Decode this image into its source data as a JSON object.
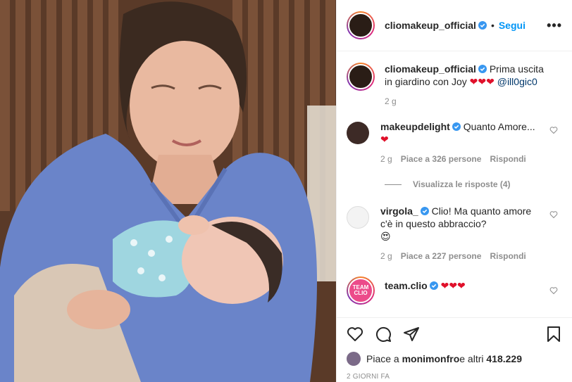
{
  "post": {
    "author": "cliomakeup_official",
    "follow_label": "Segui",
    "more_label": "•••",
    "caption_text": "Prima uscita in giardino con Joy",
    "caption_hearts": "❤❤❤",
    "caption_mention": "@ill0gic0",
    "caption_time": "2 g"
  },
  "comments": [
    {
      "user": "makeupdelight",
      "verified": true,
      "text": "Quanto Amore...",
      "emoji": "❤",
      "time": "2 g",
      "likes": "Piace a 326 persone",
      "reply": "Rispondi",
      "view_replies": "Visualizza le risposte (4)"
    },
    {
      "user": "virgola_",
      "verified": true,
      "text": "Clio! Ma quanto amore c'è in questo abbraccio?",
      "emoji": "😍",
      "time": "2 g",
      "likes": "Piace a 227 persone",
      "reply": "Rispondi"
    },
    {
      "user": "team.clio",
      "verified": true,
      "avatar_text": "TEAM CLIO",
      "emoji": "❤❤❤"
    }
  ],
  "likes_summary": {
    "prefix": "Piace a ",
    "user": "monimonfro",
    "suffix": " e altri ",
    "count": "418.229"
  },
  "date_label": "2 GIORNI FA",
  "colors": {
    "accent": "#0095f6",
    "heart": "#e0102a",
    "muted": "#8e8e8e",
    "team_clio": "#ec4b8a"
  },
  "icons": [
    "like-icon",
    "comment-icon",
    "share-icon",
    "save-icon",
    "verified-icon",
    "more-icon"
  ]
}
